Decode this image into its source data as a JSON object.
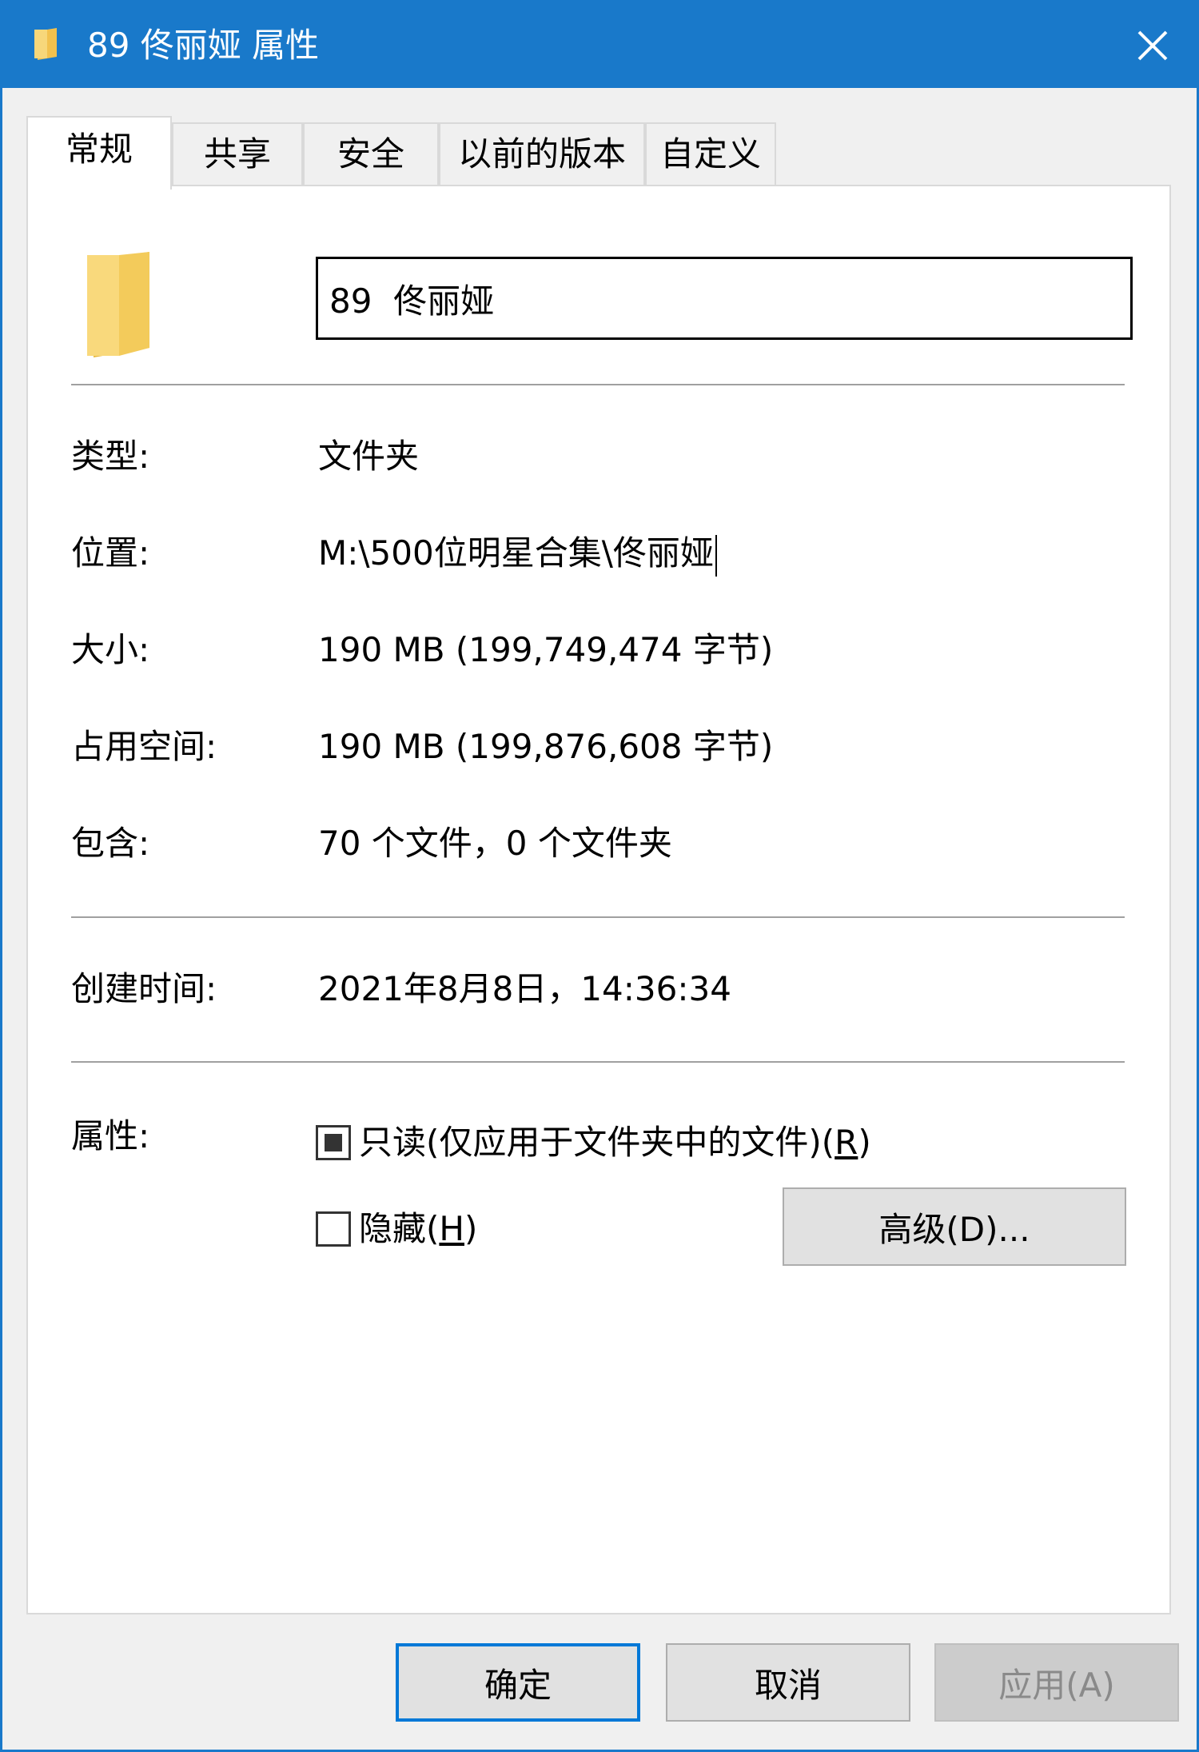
{
  "window": {
    "title": "89 佟丽娅 属性",
    "title_bar_color": "#1979ca",
    "folder_icon": "folder-icon",
    "close_icon": "close-icon"
  },
  "tabs": [
    {
      "label": "常规",
      "active": true
    },
    {
      "label": "共享",
      "active": false
    },
    {
      "label": "安全",
      "active": false
    },
    {
      "label": "以前的版本",
      "active": false
    },
    {
      "label": "自定义",
      "active": false
    }
  ],
  "general": {
    "name_value": "89  佟丽娅",
    "rows": [
      {
        "label": "类型:",
        "value": "文件夹"
      },
      {
        "label": "位置:",
        "value": "M:\\500位明星合集\\佟丽娅"
      },
      {
        "label": "大小:",
        "value": "190 MB (199,749,474 字节)"
      },
      {
        "label": "占用空间:",
        "value": "190 MB (199,876,608 字节)"
      },
      {
        "label": "包含:",
        "value": "70 个文件，0 个文件夹"
      }
    ],
    "created": {
      "label": "创建时间:",
      "value": "2021年8月8日，14:36:34"
    },
    "attributes": {
      "label": "属性:",
      "readonly_text": "只读(仅应用于文件夹中的文件)(",
      "readonly_key": "R",
      "readonly_end": ")",
      "readonly_state": "indeterminate",
      "hidden_text": "隐藏(",
      "hidden_key": "H",
      "hidden_end": ")",
      "hidden_checked": false,
      "advanced_label": "高级(D)..."
    }
  },
  "footer": {
    "ok_label": "确定",
    "cancel_label": "取消",
    "apply_label": "应用(A)",
    "accent": "#0078d7"
  }
}
